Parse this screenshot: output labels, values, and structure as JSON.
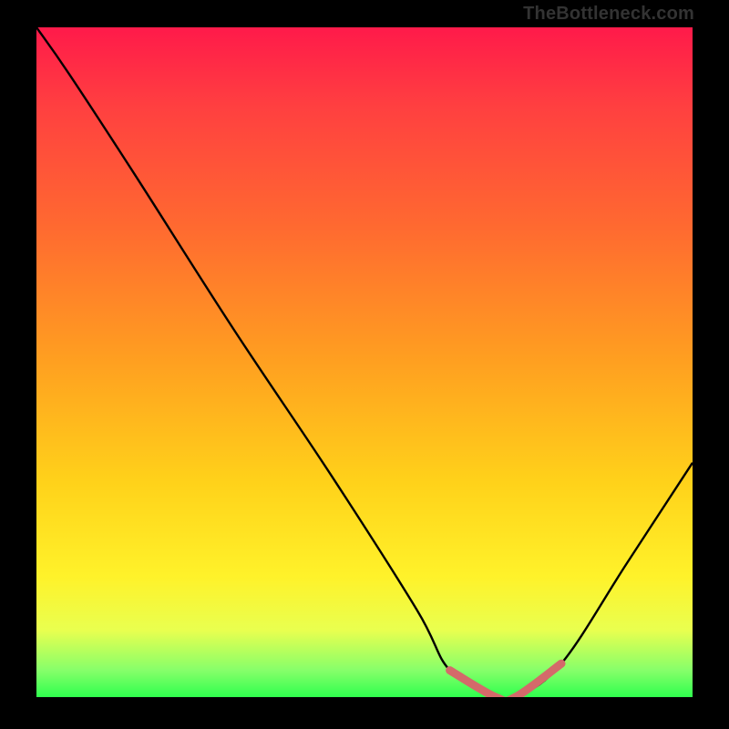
{
  "watermark": "TheBottleneck.com",
  "chart_data": {
    "type": "line",
    "title": "",
    "xlabel": "",
    "ylabel": "",
    "xlim": [
      0,
      100
    ],
    "ylim": [
      0,
      100
    ],
    "series": [
      {
        "name": "bottleneck-curve",
        "x": [
          0,
          5,
          15,
          30,
          45,
          58,
          63,
          70,
          73,
          80,
          90,
          100
        ],
        "values": [
          100,
          93,
          78,
          55,
          33,
          13,
          4,
          0,
          0,
          5,
          20,
          35
        ]
      },
      {
        "name": "highlight-segment",
        "x": [
          63,
          70,
          73,
          80
        ],
        "values": [
          4,
          0,
          0,
          5
        ]
      }
    ]
  }
}
